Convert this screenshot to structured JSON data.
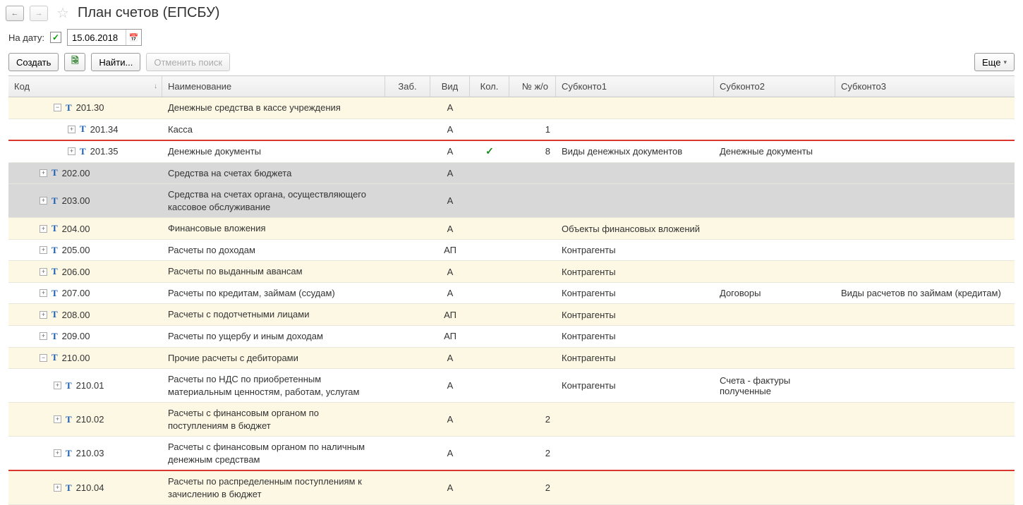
{
  "header": {
    "title": "План счетов (ЕПСБУ)"
  },
  "filter": {
    "date_label": "На дату:",
    "date_value": "15.06.2018",
    "date_checked": true
  },
  "toolbar": {
    "create": "Создать",
    "find": "Найти...",
    "cancel_search": "Отменить поиск",
    "more": "Еще"
  },
  "columns": {
    "code": "Код",
    "name": "Наименование",
    "zab": "Заб.",
    "vid": "Вид",
    "kol": "Кол.",
    "num": "№ ж/о",
    "s1": "Субконто1",
    "s2": "Субконто2",
    "s3": "Субконто3"
  },
  "rows": [
    {
      "style": "yellow",
      "indent": 50,
      "exp": "minus",
      "code": "201.30",
      "name": "Денежные средства  в кассе учреждения",
      "vid": "А",
      "kol": "",
      "num": "",
      "s1": "",
      "s2": "",
      "s3": "",
      "red": false
    },
    {
      "style": "",
      "indent": 70,
      "exp": "plus",
      "code": "201.34",
      "name": "Касса",
      "vid": "А",
      "kol": "",
      "num": "1",
      "s1": "",
      "s2": "",
      "s3": "",
      "red": true
    },
    {
      "style": "",
      "indent": 70,
      "exp": "plus",
      "code": "201.35",
      "name": "Денежные документы",
      "vid": "А",
      "kol": "✓",
      "num": "8",
      "s1": "Виды денежных документов",
      "s2": "Денежные документы",
      "s3": "",
      "red": false
    },
    {
      "style": "gray",
      "indent": 30,
      "exp": "plus",
      "code": "202.00",
      "name": "Средства на счетах бюджета",
      "vid": "А",
      "kol": "",
      "num": "",
      "s1": "",
      "s2": "",
      "s3": "",
      "red": false
    },
    {
      "style": "gray",
      "indent": 30,
      "exp": "plus",
      "code": "203.00",
      "name": "Средства на счетах органа, осуществляющего кассовое обслуживание",
      "vid": "А",
      "kol": "",
      "num": "",
      "s1": "",
      "s2": "",
      "s3": "",
      "red": false
    },
    {
      "style": "yellow",
      "indent": 30,
      "exp": "plus",
      "code": "204.00",
      "name": "Финансовые вложения",
      "vid": "А",
      "kol": "",
      "num": "",
      "s1": "Объекты финансовых вложений",
      "s2": "",
      "s3": "",
      "red": false
    },
    {
      "style": "",
      "indent": 30,
      "exp": "plus",
      "code": "205.00",
      "name": "Расчеты по доходам",
      "vid": "АП",
      "kol": "",
      "num": "",
      "s1": "Контрагенты",
      "s2": "",
      "s3": "",
      "red": false
    },
    {
      "style": "yellow",
      "indent": 30,
      "exp": "plus",
      "code": "206.00",
      "name": "Расчеты по выданным авансам",
      "vid": "А",
      "kol": "",
      "num": "",
      "s1": "Контрагенты",
      "s2": "",
      "s3": "",
      "red": false
    },
    {
      "style": "",
      "indent": 30,
      "exp": "plus",
      "code": "207.00",
      "name": "Расчеты по кредитам, займам (ссудам)",
      "vid": "А",
      "kol": "",
      "num": "",
      "s1": "Контрагенты",
      "s2": "Договоры",
      "s3": "Виды расчетов по займам (кредитам)",
      "red": false
    },
    {
      "style": "yellow",
      "indent": 30,
      "exp": "plus",
      "code": "208.00",
      "name": "Расчеты с подотчетными лицами",
      "vid": "АП",
      "kol": "",
      "num": "",
      "s1": "Контрагенты",
      "s2": "",
      "s3": "",
      "red": false
    },
    {
      "style": "",
      "indent": 30,
      "exp": "plus",
      "code": "209.00",
      "name": "Расчеты по ущербу и иным доходам",
      "vid": "АП",
      "kol": "",
      "num": "",
      "s1": "Контрагенты",
      "s2": "",
      "s3": "",
      "red": false
    },
    {
      "style": "yellow",
      "indent": 30,
      "exp": "minus",
      "code": "210.00",
      "name": "Прочие расчеты с дебиторами",
      "vid": "А",
      "kol": "",
      "num": "",
      "s1": "Контрагенты",
      "s2": "",
      "s3": "",
      "red": false
    },
    {
      "style": "",
      "indent": 50,
      "exp": "plus",
      "code": "210.01",
      "name": "Расчеты по НДС по приобретенным материальным ценностям, работам, услугам",
      "vid": "А",
      "kol": "",
      "num": "",
      "s1": "Контрагенты",
      "s2": "Счета - фактуры полученные",
      "s3": "",
      "red": false
    },
    {
      "style": "yellow",
      "indent": 50,
      "exp": "plus",
      "code": "210.02",
      "name": "Расчеты с финансовым органом по поступлениям в бюджет",
      "vid": "А",
      "kol": "",
      "num": "2",
      "s1": "",
      "s2": "",
      "s3": "",
      "red": false
    },
    {
      "style": "",
      "indent": 50,
      "exp": "plus",
      "code": "210.03",
      "name": "Расчеты с финансовым органом по наличным денежным средствам",
      "vid": "А",
      "kol": "",
      "num": "2",
      "s1": "",
      "s2": "",
      "s3": "",
      "red": true
    },
    {
      "style": "yellow",
      "indent": 50,
      "exp": "plus",
      "code": "210.04",
      "name": "Расчеты по распределенным поступлениям к зачислению в бюджет",
      "vid": "А",
      "kol": "",
      "num": "2",
      "s1": "",
      "s2": "",
      "s3": "",
      "red": false
    }
  ]
}
